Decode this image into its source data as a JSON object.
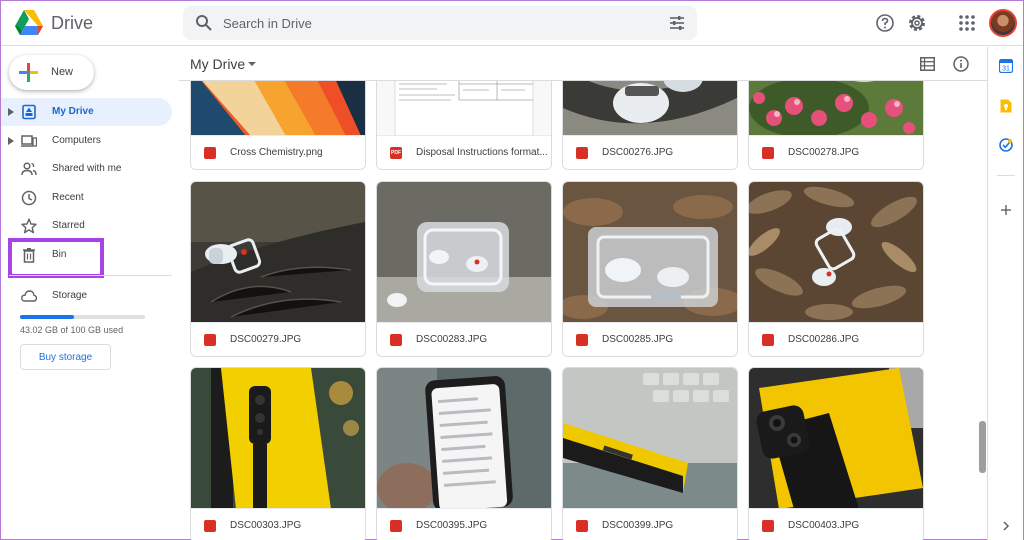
{
  "app": {
    "title": "Drive"
  },
  "search": {
    "placeholder": "Search in Drive"
  },
  "sidebar": {
    "new_label": "New",
    "items": [
      {
        "label": "My Drive",
        "active": true
      },
      {
        "label": "Computers"
      },
      {
        "label": "Shared with me"
      },
      {
        "label": "Recent"
      },
      {
        "label": "Starred"
      },
      {
        "label": "Bin"
      },
      {
        "label": "Storage"
      }
    ],
    "storage": {
      "used_text": "43.02 GB of 100 GB used",
      "used_fraction": 0.43,
      "buy_label": "Buy storage"
    }
  },
  "main": {
    "title": "My Drive",
    "files": [
      {
        "name": "Cross Chemistry.png",
        "type": "image"
      },
      {
        "name": "Disposal Instructions format...",
        "type": "pdf",
        "badge": "PDF"
      },
      {
        "name": "DSC00276.JPG",
        "type": "image"
      },
      {
        "name": "DSC00278.JPG",
        "type": "image"
      },
      {
        "name": "DSC00279.JPG",
        "type": "image"
      },
      {
        "name": "DSC00283.JPG",
        "type": "image"
      },
      {
        "name": "DSC00285.JPG",
        "type": "image"
      },
      {
        "name": "DSC00286.JPG",
        "type": "image"
      },
      {
        "name": "DSC00303.JPG",
        "type": "image"
      },
      {
        "name": "DSC00395.JPG",
        "type": "image"
      },
      {
        "name": "DSC00399.JPG",
        "type": "image"
      },
      {
        "name": "DSC00403.JPG",
        "type": "image"
      }
    ]
  },
  "colors": {
    "accent": "#1a73e8",
    "highlight": "#a644e8",
    "active_bg": "#e8f0fe",
    "image_icon": "#d93025"
  }
}
